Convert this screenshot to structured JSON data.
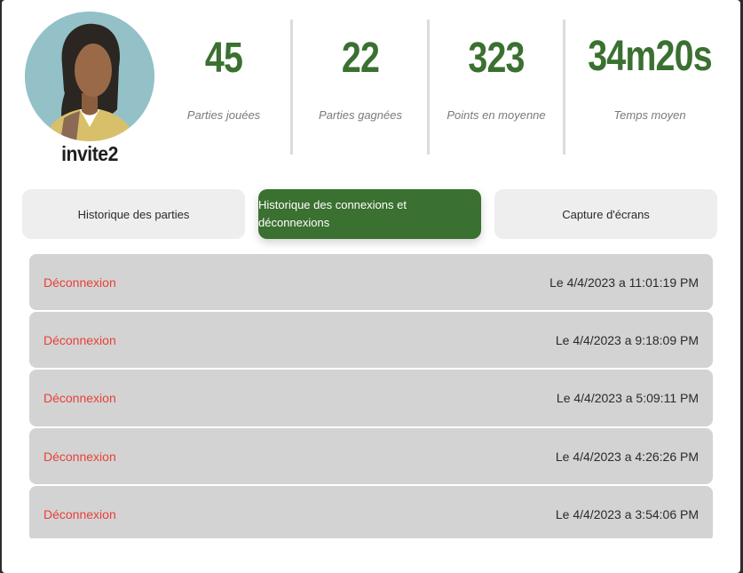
{
  "profile": {
    "username": "invite2"
  },
  "stats": [
    {
      "value": "45",
      "label": "Parties jouées"
    },
    {
      "value": "22",
      "label": "Parties gagnées"
    },
    {
      "value": "323",
      "label": "Points en moyenne"
    },
    {
      "value": "34m20s",
      "label": "Temps moyen"
    }
  ],
  "tabs": [
    {
      "label": "Historique des parties"
    },
    {
      "label": "Historique des connexions et déconnexions"
    },
    {
      "label": "Capture d'écrans"
    }
  ],
  "active_tab": 1,
  "colors": {
    "accent": "#3a7030",
    "event_text": "#e8403a",
    "row_background": "#d3d3d3",
    "tab_background": "#eeeeee"
  },
  "connections": [
    {
      "event": "Déconnexion",
      "time": "Le 4/4/2023 a 11:01:19 PM"
    },
    {
      "event": "Déconnexion",
      "time": "Le 4/4/2023 a 9:18:09 PM"
    },
    {
      "event": "Déconnexion",
      "time": "Le 4/4/2023 a 5:09:11 PM"
    },
    {
      "event": "Déconnexion",
      "time": "Le 4/4/2023 a 4:26:26 PM"
    },
    {
      "event": "Déconnexion",
      "time": "Le 4/4/2023 a 3:54:06 PM"
    }
  ]
}
